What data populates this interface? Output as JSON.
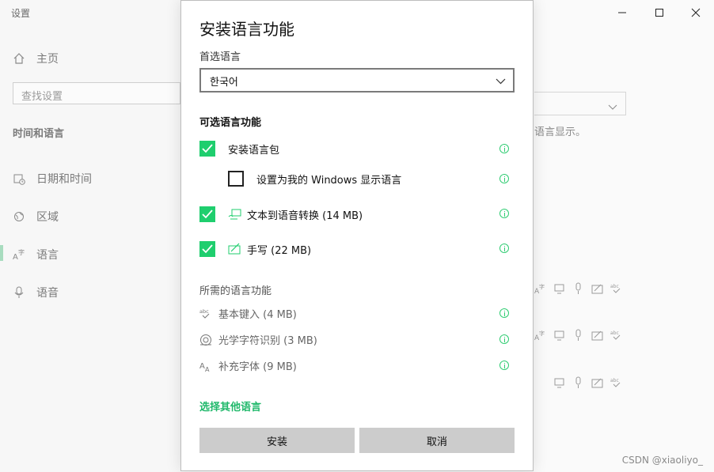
{
  "background": {
    "window_title": "设置",
    "nav": {
      "home": "主页",
      "search_placeholder": "查找设置",
      "section": "时间和语言",
      "items": [
        {
          "label": "日期和时间",
          "icon": "calendar-clock-icon"
        },
        {
          "label": "区域",
          "icon": "globe-icon"
        },
        {
          "label": "语言",
          "icon": "language-icon",
          "selected": true
        },
        {
          "label": "语音",
          "icon": "microphone-icon"
        }
      ]
    },
    "right_fragment_text": "语言显示。"
  },
  "dialog": {
    "title": "安装语言功能",
    "preferred_label": "首选语言",
    "preferred_value": "한국어",
    "optional_title": "可选语言功能",
    "options": [
      {
        "label": "安装语言包",
        "checked": true
      },
      {
        "label": "设置为我的 Windows 显示语言",
        "checked": false
      },
      {
        "label": "文本到语音转换 (14 MB)",
        "checked": true,
        "icon": "text-to-speech-icon"
      },
      {
        "label": "手写 (22 MB)",
        "checked": true,
        "icon": "handwriting-icon"
      }
    ],
    "required_title": "所需的语言功能",
    "required": [
      {
        "label": "基本键入 (4 MB)",
        "icon": "abc-typing-icon"
      },
      {
        "label": "光学字符识别 (3 MB)",
        "icon": "ocr-icon"
      },
      {
        "label": "补充字体 (9 MB)",
        "icon": "font-icon"
      }
    ],
    "link": "选择其他语言",
    "install_label": "安装",
    "cancel_label": "取消"
  },
  "watermark": "CSDN @xiaoliyo_",
  "colors": {
    "accent": "#1fce6e",
    "button": "#cccccc"
  }
}
